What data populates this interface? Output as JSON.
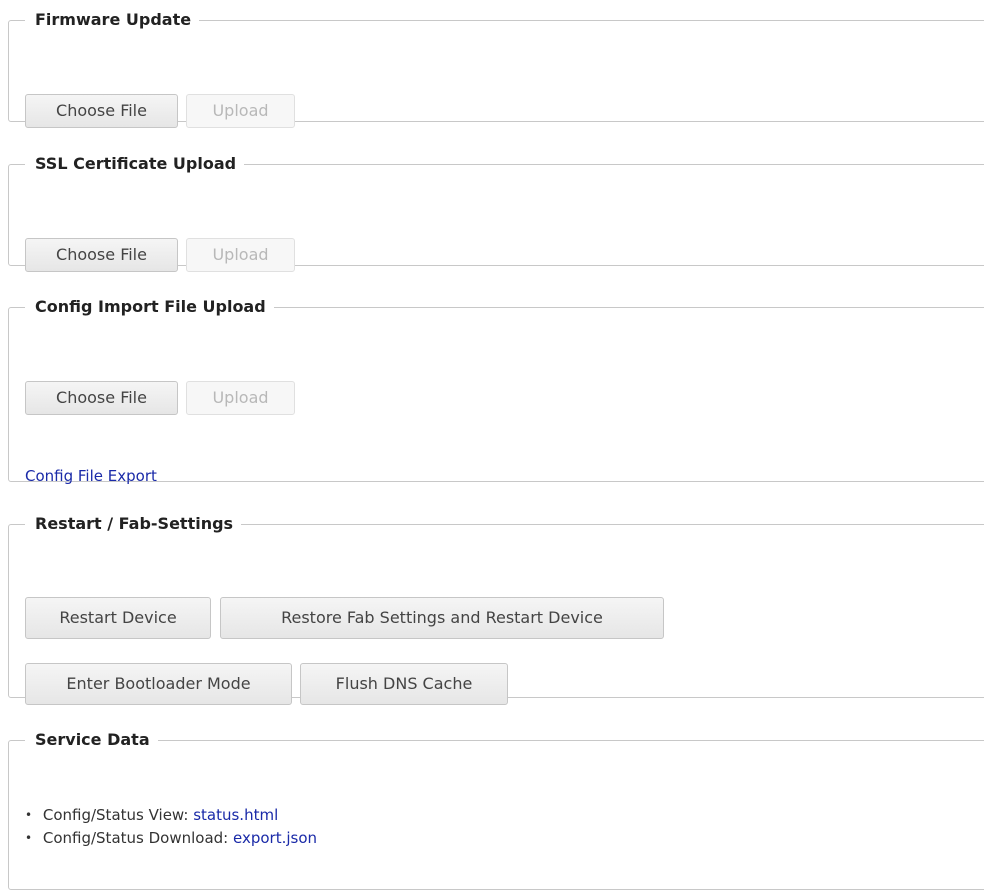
{
  "firmware": {
    "title": "Firmware Update",
    "choose_label": "Choose File",
    "upload_label": "Upload"
  },
  "ssl": {
    "title": "SSL Certificate Upload",
    "choose_label": "Choose File",
    "upload_label": "Upload"
  },
  "config_import": {
    "title": "Config Import File Upload",
    "choose_label": "Choose File",
    "upload_label": "Upload",
    "export_link": "Config File Export"
  },
  "restart": {
    "title": "Restart / Fab-Settings",
    "restart_label": "Restart Device",
    "restore_label": "Restore Fab Settings and Restart Device",
    "bootloader_label": "Enter Bootloader Mode",
    "flush_dns_label": "Flush DNS Cache"
  },
  "service": {
    "title": "Service Data",
    "items": [
      {
        "label": "Config/Status View:",
        "link": "status.html"
      },
      {
        "label": "Config/Status Download:",
        "link": "export.json"
      }
    ]
  },
  "colors": {
    "link": "#1a2aa8",
    "border": "#c8c8c8",
    "disabled_text": "#b8b8b8"
  }
}
